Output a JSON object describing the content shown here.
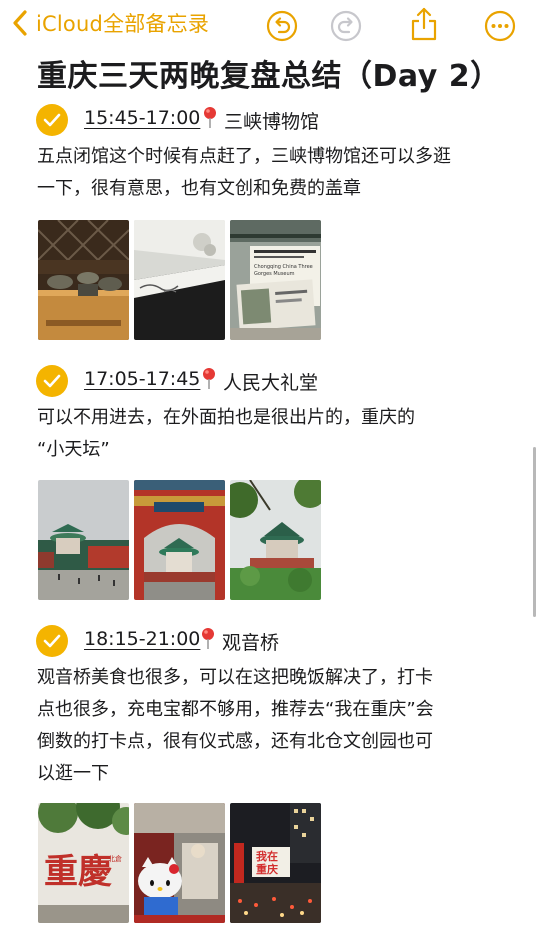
{
  "colors": {
    "accent": "#E9A300",
    "check": "#F4B400",
    "pin": "#E53935"
  },
  "nav": {
    "back_label": "iCloud全部备忘录",
    "icons": [
      "chevron-left-icon",
      "undo-icon",
      "redo-icon",
      "share-icon",
      "more-icon"
    ]
  },
  "note": {
    "title": "重庆三天两晚复盘总结（Day 2）",
    "sections": [
      {
        "time": "15:45-17:00",
        "place": "三峡博物馆",
        "lines": [
          "五点闭馆这个时候有点赶了，三峡博物馆还可以多逛",
          "一下，很有意思，也有文创和免费的盖章"
        ],
        "photos": [
          "bronze-artifacts-photo",
          "display-case-photo",
          "museum-ticket-photo"
        ]
      },
      {
        "time": "17:05-17:45",
        "place": "人民大礼堂",
        "lines": [
          "可以不用进去，在外面拍也是很出片的，重庆的",
          "“小天坛”"
        ],
        "photos": [
          "great-hall-plaza-photo",
          "great-hall-gate-photo",
          "great-hall-trees-photo"
        ]
      },
      {
        "time": "18:15-21:00",
        "place": "观音桥",
        "lines": [
          "观音桥美食也很多，可以在这把晚饭解决了，打卡",
          "点也很多，充电宝都不够用，推荐去“我在重庆”会",
          "倒数的打卡点，很有仪式感，还有北仓文创园也可",
          "以逛一下"
        ],
        "photos": [
          "chongqing-calligraphy-wall-photo",
          "hello-kitty-statue-photo",
          "night-street-sign-photo"
        ]
      }
    ],
    "photo_signs": {
      "ticket_line1": "Chongqing China Three",
      "ticket_line2": "Gorges Museum",
      "wall_chars": "重慶",
      "wall_small": "北倉",
      "sign_line1": "我在",
      "sign_line2": "重庆"
    }
  }
}
